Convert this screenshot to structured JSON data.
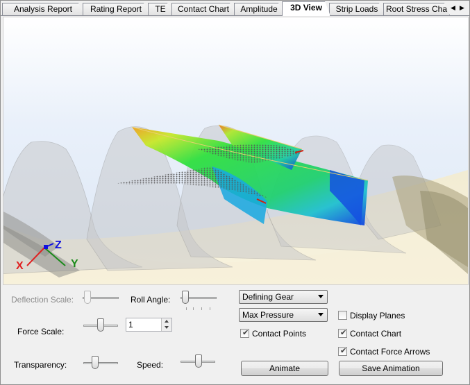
{
  "tabs": [
    {
      "label": "Analysis Report",
      "active": false
    },
    {
      "label": "Rating Report",
      "active": false
    },
    {
      "label": "TE",
      "active": false
    },
    {
      "label": "Contact Chart",
      "active": false
    },
    {
      "label": "Amplitude",
      "active": false
    },
    {
      "label": "3D View",
      "active": true
    },
    {
      "label": "Strip Loads",
      "active": false
    },
    {
      "label": "Root Stress Cha",
      "active": false
    }
  ],
  "tab_scroll": {
    "left": "◀",
    "right": "▶"
  },
  "axes_triad": {
    "x": "X",
    "y": "Y",
    "z": "Z",
    "x_color": "#e02020",
    "y_color": "#1a8a1a",
    "z_color": "#1010e0"
  },
  "controls": {
    "deflection_scale": {
      "label": "Deflection Scale:",
      "enabled": false
    },
    "roll_angle": {
      "label": "Roll Angle:"
    },
    "force_scale": {
      "label": "Force Scale:",
      "value": "1"
    },
    "transparency": {
      "label": "Transparency:"
    },
    "speed": {
      "label": "Speed:"
    },
    "gear_select": {
      "value": "Defining Gear"
    },
    "result_select": {
      "value": "Max Pressure"
    },
    "contact_points": {
      "label": "Contact Points",
      "checked": true
    },
    "display_planes": {
      "label": "Display Planes",
      "checked": false
    },
    "contact_chart": {
      "label": "Contact Chart",
      "checked": true
    },
    "contact_force_arrows": {
      "label": "Contact Force Arrows",
      "checked": true
    },
    "animate_button": "Animate",
    "save_animation_button": "Save Animation"
  },
  "colors": {
    "accent_green": "#2ee02e",
    "accent_blue": "#1040e0",
    "accent_red": "#e03010"
  }
}
